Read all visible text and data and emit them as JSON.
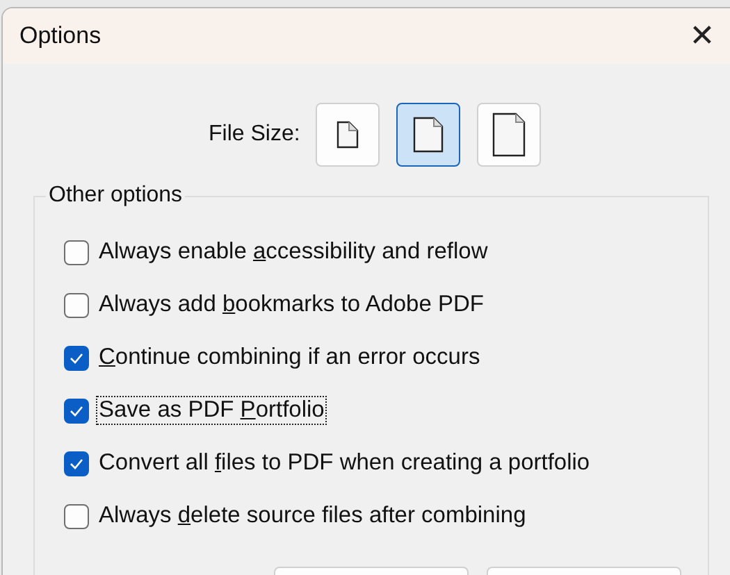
{
  "window": {
    "title": "Options",
    "close": "✕"
  },
  "file_size": {
    "label": "File Size:",
    "options": [
      {
        "selected": false
      },
      {
        "selected": true
      },
      {
        "selected": false
      }
    ]
  },
  "group": {
    "title": "Other options",
    "options": [
      {
        "before": "Always enable ",
        "key": "a",
        "after": "ccessibility and reflow",
        "checked": false,
        "focused": false
      },
      {
        "before": "Always add ",
        "key": "b",
        "after": "ookmarks to Adobe PDF",
        "checked": false,
        "focused": false
      },
      {
        "key": "C",
        "after": "ontinue combining if an error occurs",
        "checked": true,
        "focused": false
      },
      {
        "before": "Save as PDF ",
        "key": "P",
        "after": "ortfolio",
        "checked": true,
        "focused": true
      },
      {
        "before": "Convert all ",
        "key": "f",
        "after": "iles to PDF when creating a portfolio",
        "checked": true,
        "focused": false
      },
      {
        "before": "Always ",
        "key": "d",
        "after": "elete source files after combining",
        "checked": false,
        "focused": false
      }
    ]
  }
}
